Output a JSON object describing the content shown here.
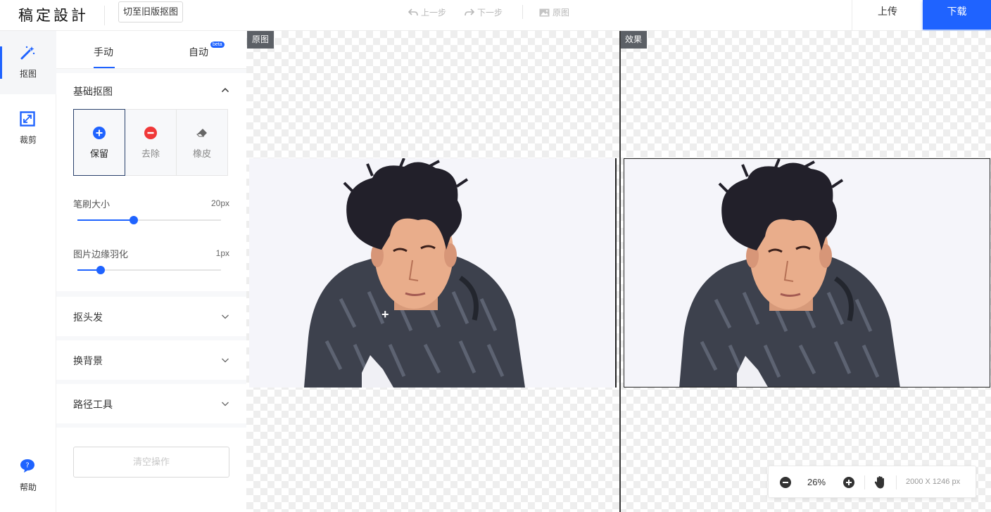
{
  "header": {
    "logo": "稿定設計",
    "switch_old_label": "切至旧版抠图",
    "undo_label": "上一步",
    "redo_label": "下一步",
    "original_label": "原图",
    "upload_label": "上传",
    "download_label": "下载"
  },
  "rail": {
    "items": [
      {
        "label": "抠图",
        "icon": "magic-wand-icon",
        "active": true
      },
      {
        "label": "裁剪",
        "icon": "crop-icon",
        "active": false
      }
    ],
    "help_label": "帮助"
  },
  "panel": {
    "tabs": [
      {
        "label": "手动",
        "active": true
      },
      {
        "label": "自动",
        "active": false,
        "badge": "beta"
      }
    ],
    "basic": {
      "title": "基础抠图",
      "modes": [
        {
          "label": "保留",
          "icon": "plus-circle-icon",
          "color": "#1f63ff",
          "selected": true
        },
        {
          "label": "去除",
          "icon": "minus-circle-icon",
          "color": "#f03838",
          "selected": false
        },
        {
          "label": "橡皮",
          "icon": "eraser-icon",
          "color": "#666666",
          "selected": false
        }
      ],
      "brush_label": "笔刷大小",
      "brush_value": "20px",
      "brush_fraction": 0.39,
      "feather_label": "图片边缘羽化",
      "feather_value": "1px",
      "feather_fraction": 0.16
    },
    "sections": [
      "抠头发",
      "换背景",
      "路径工具"
    ],
    "clear_label": "清空操作"
  },
  "canvas": {
    "left_tag": "原图",
    "right_tag": "效果",
    "zoom": "26%",
    "dimensions": "2000 X 1246 px"
  },
  "colors": {
    "accent": "#1f63ff",
    "remove": "#f03838"
  }
}
